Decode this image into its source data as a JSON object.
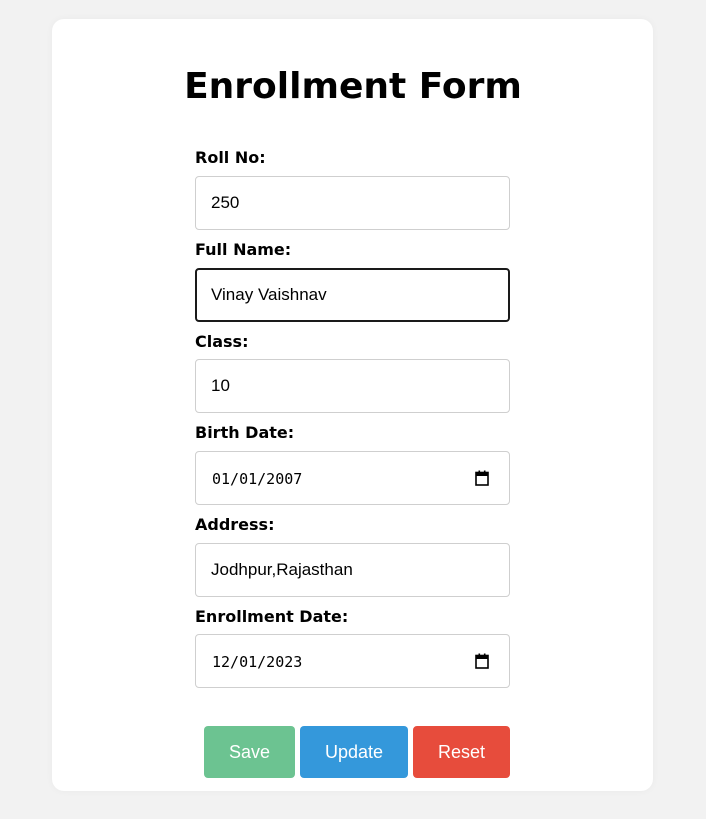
{
  "form": {
    "title": "Enrollment Form",
    "roll_no": {
      "label": "Roll No:",
      "value": "250"
    },
    "full_name": {
      "label": "Full Name:",
      "value": "Vinay Vaishnav"
    },
    "class": {
      "label": "Class:",
      "value": "10"
    },
    "birth_date": {
      "label": "Birth Date:",
      "value": "01/01/2007"
    },
    "address": {
      "label": "Address:",
      "value": "Jodhpur,Rajasthan"
    },
    "enrollment_date": {
      "label": "Enrollment Date:",
      "value": "12/01/2023"
    }
  },
  "buttons": {
    "save": "Save",
    "update": "Update",
    "reset": "Reset"
  },
  "colors": {
    "save": "#6cc391",
    "update": "#3498db",
    "reset": "#e74c3c",
    "page_background": "#f2f2f2",
    "card_background": "#ffffff"
  },
  "icons": {
    "calendar": "calendar-icon"
  }
}
